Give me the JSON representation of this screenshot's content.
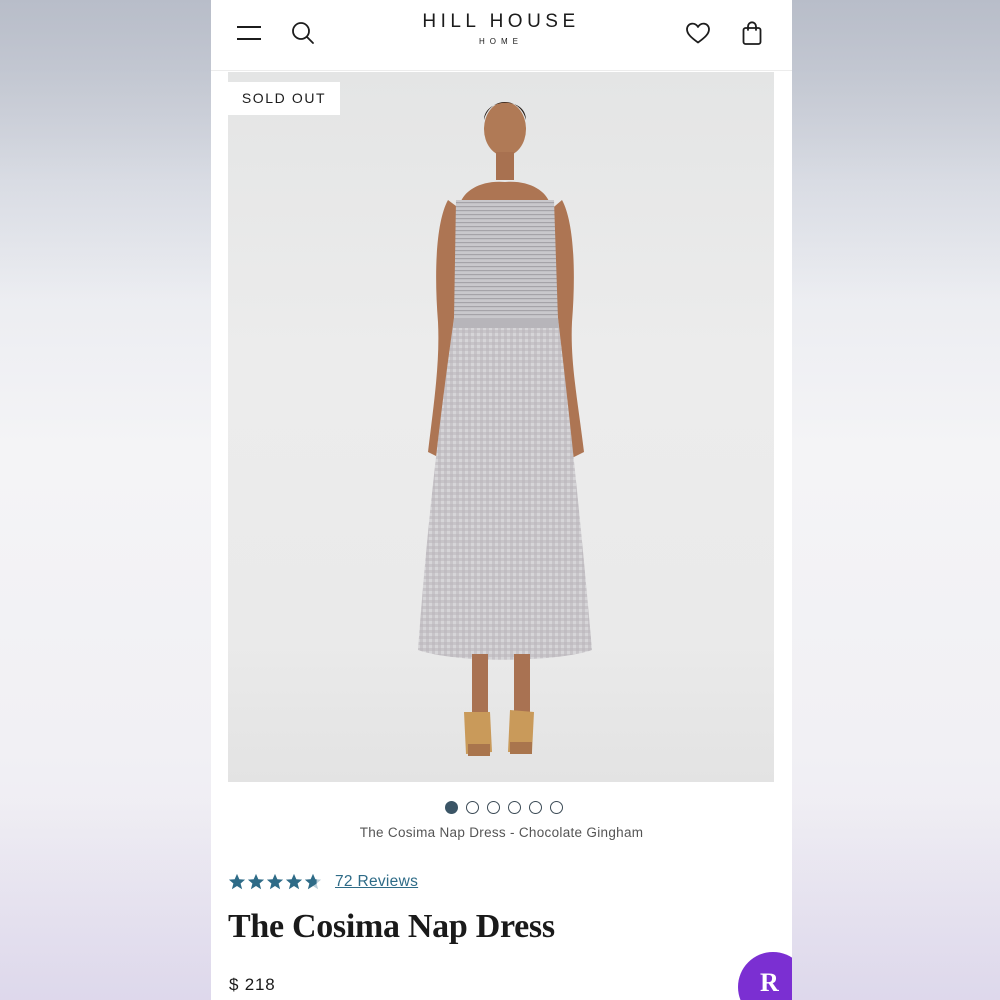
{
  "header": {
    "brand": "HILL HOUSE",
    "brand_sub": "HOME"
  },
  "icons": {
    "menu": "menu-icon",
    "search": "search-icon",
    "wishlist": "heart-icon",
    "cart": "shopping-bag-icon"
  },
  "gallery": {
    "badge": "SOLD OUT",
    "slide_count": 6,
    "active_slide": 1,
    "caption": "The Cosima Nap Dress - Chocolate Gingham"
  },
  "product": {
    "rating": 4.5,
    "reviews_label": "72 Reviews",
    "title": "The Cosima Nap Dress",
    "price": "$ 218"
  },
  "floating_badge": {
    "letter": "R"
  },
  "colors": {
    "accent": "#2e6b87",
    "star": "#2e6b87",
    "floating": "#7b2fd2"
  }
}
